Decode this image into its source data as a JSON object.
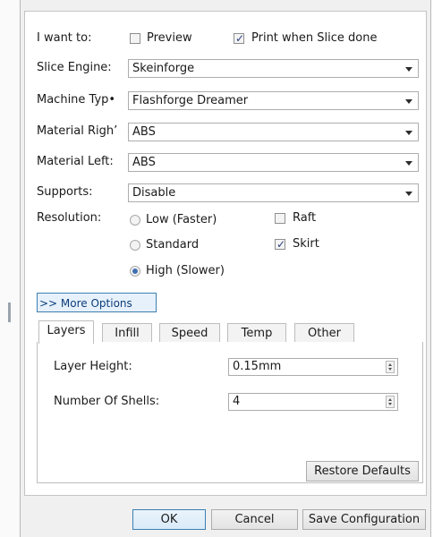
{
  "want": {
    "label": "I want to:",
    "preview_label": "Preview",
    "preview_checked": false,
    "print_label": "Print when Slice done",
    "print_checked": true
  },
  "slice_engine": {
    "label": "Slice Engine:",
    "value": "Skeinforge"
  },
  "machine_type": {
    "label": "Machine Typ•",
    "value": "Flashforge Dreamer"
  },
  "material_right": {
    "label": "Material Righ’",
    "value": "ABS"
  },
  "material_left": {
    "label": "Material Left:",
    "value": "ABS"
  },
  "supports": {
    "label": "Supports:",
    "value": "Disable"
  },
  "resolution": {
    "label": "Resolution:",
    "options": [
      "Low (Faster)",
      "Standard",
      "High (Slower)"
    ],
    "selected": "High (Slower)"
  },
  "raft": {
    "label": "Raft",
    "checked": false
  },
  "skirt": {
    "label": "Skirt",
    "checked": true
  },
  "more_options_label": ">> More Options",
  "tabs": [
    "Layers",
    "Infill",
    "Speed",
    "Temp",
    "Other"
  ],
  "active_tab": "Layers",
  "layers": {
    "layer_height_label": "Layer Height:",
    "layer_height_value": "0.15mm",
    "shells_label": "Number Of Shells:",
    "shells_value": "4"
  },
  "restore_defaults_label": "Restore Defaults",
  "footer": {
    "ok_label": "OK",
    "cancel_label": "Cancel",
    "save_label": "Save Configuration"
  },
  "colors": {
    "accent": "#3c7fb1",
    "check_tick": "#2a3e7a",
    "radio_dot": "#3f6fb0"
  }
}
